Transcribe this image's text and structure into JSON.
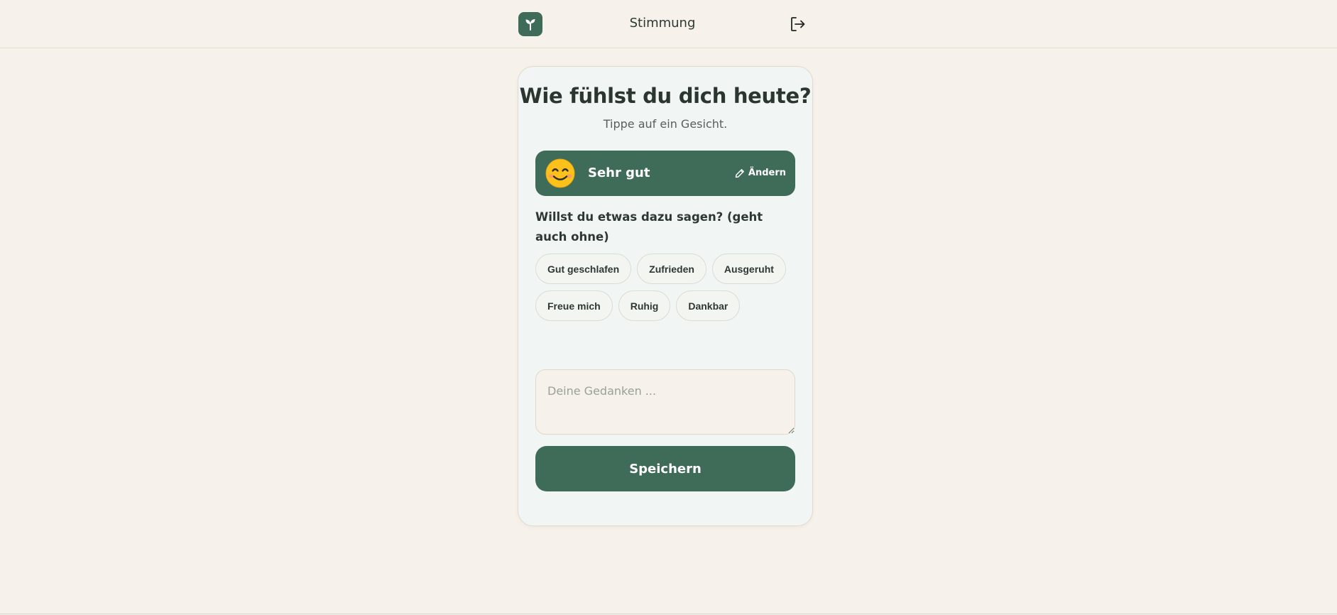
{
  "header": {
    "title": "Stimmung",
    "logo_icon": "sprout-icon",
    "logout_icon": "logout-icon"
  },
  "card": {
    "title": "Wie fühlst du dich heute?",
    "subtitle": "Tippe auf ein Gesicht.",
    "selected_mood": {
      "emoji": "😊",
      "label": "Sehr gut",
      "change_label": "Ändern",
      "change_icon": "pencil-icon"
    },
    "question": "Willst du etwas dazu sagen? (geht auch ohne)",
    "tags": [
      "Gut geschlafen",
      "Zufrieden",
      "Ausgeruht",
      "Freue mich",
      "Ruhig",
      "Dankbar"
    ],
    "thoughts": {
      "value": "",
      "placeholder": "Deine Gedanken ..."
    },
    "save_label": "Speichern"
  },
  "colors": {
    "background": "#f6f1ea",
    "card": "#f1f5f3",
    "accent": "#3f6b59",
    "text": "#2d3833"
  }
}
